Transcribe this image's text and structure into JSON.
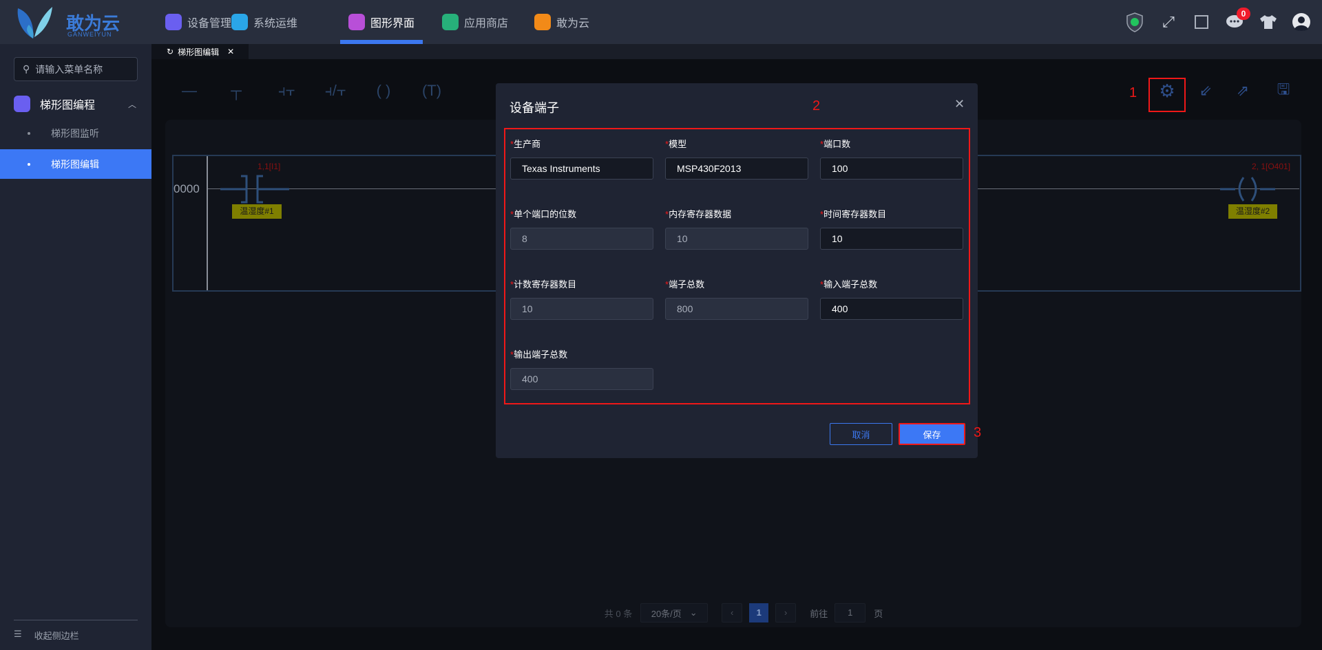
{
  "header": {
    "logo_text": "敢为云",
    "logo_sub": "GANWEIYUN",
    "nav": [
      {
        "label": "设备管理",
        "color": "#6a5ff0"
      },
      {
        "label": "系统运维",
        "color": "#2aa6e8"
      },
      {
        "label": "图形界面",
        "color": "#b84fd8"
      },
      {
        "label": "应用商店",
        "color": "#27b07a"
      },
      {
        "label": "敢为云",
        "color": "#f28a18"
      }
    ],
    "active_nav": "图形界面",
    "notification_count": "0"
  },
  "sidebar": {
    "search_placeholder": "请输入菜单名称",
    "group": "梯形图编程",
    "items": [
      "梯形图监听",
      "梯形图编辑"
    ],
    "active_item": "梯形图编辑",
    "collapse_label": "收起侧边栏"
  },
  "tabs": [
    {
      "label": "梯形图编辑"
    }
  ],
  "ladder": {
    "rung_number": "0000",
    "contact": {
      "address": "1,1[I1]",
      "name": "温湿度#1"
    },
    "coil": {
      "address": "2, 1[O401]",
      "name": "温湿度#2"
    }
  },
  "annotations": [
    "1",
    "2",
    "3"
  ],
  "pagination": {
    "total": "共 0 条",
    "page_size": "20条/页",
    "current_page": "1",
    "goto_label": "前往",
    "goto_value": "1",
    "page_suffix": "页"
  },
  "dialog": {
    "title": "设备端子",
    "fields": [
      {
        "label": "生产商",
        "value": "Texas Instruments",
        "disabled": false
      },
      {
        "label": "模型",
        "value": "MSP430F2013",
        "disabled": false
      },
      {
        "label": "端口数",
        "value": "100",
        "disabled": false
      },
      {
        "label": "单个端口的位数",
        "value": "8",
        "disabled": true
      },
      {
        "label": "内存寄存器数据",
        "value": "10",
        "disabled": true
      },
      {
        "label": "时间寄存器数目",
        "value": "10",
        "disabled": false
      },
      {
        "label": "计数寄存器数目",
        "value": "10",
        "disabled": true
      },
      {
        "label": "端子总数",
        "value": "800",
        "disabled": true
      },
      {
        "label": "输入端子总数",
        "value": "400",
        "disabled": false
      },
      {
        "label": "输出端子总数",
        "value": "400",
        "disabled": true
      }
    ],
    "required_mark": "*",
    "cancel_label": "取消",
    "save_label": "保存"
  }
}
